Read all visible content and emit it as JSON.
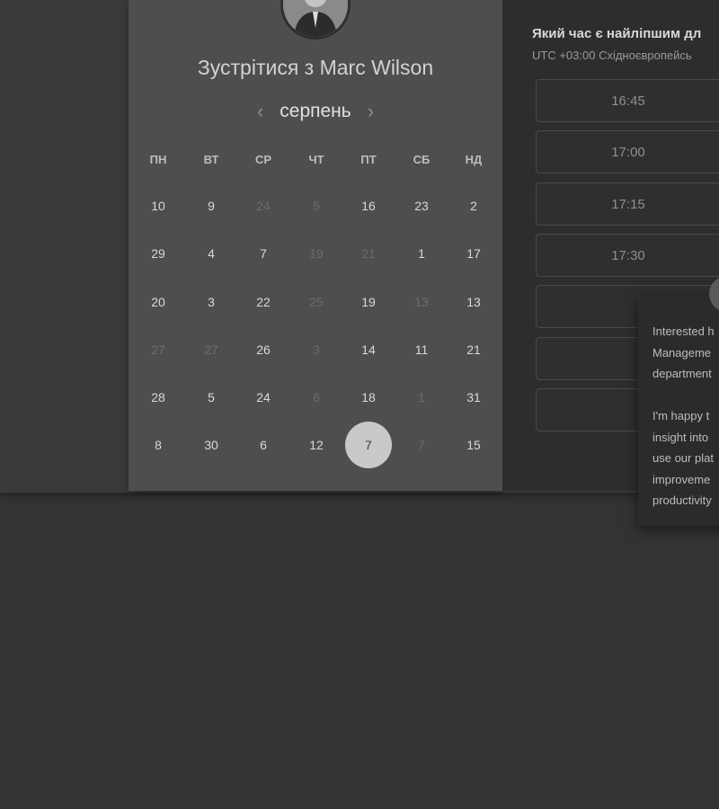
{
  "header": {
    "title": "Зустрітися з Marc Wilson",
    "month": "серпень",
    "prev_icon": "chevron-left-icon",
    "next_icon": "chevron-right-icon"
  },
  "calendar": {
    "weekdays": [
      "ПН",
      "ВТ",
      "СР",
      "ЧТ",
      "ПТ",
      "СБ",
      "НД"
    ],
    "weeks": [
      [
        {
          "d": "10"
        },
        {
          "d": "9"
        },
        {
          "d": "24",
          "muted": true
        },
        {
          "d": "5",
          "muted": true
        },
        {
          "d": "16"
        },
        {
          "d": "23"
        },
        {
          "d": "2"
        }
      ],
      [
        {
          "d": "29"
        },
        {
          "d": "4"
        },
        {
          "d": "7"
        },
        {
          "d": "19",
          "muted": true
        },
        {
          "d": "21",
          "muted": true
        },
        {
          "d": "1"
        },
        {
          "d": "17"
        }
      ],
      [
        {
          "d": "20"
        },
        {
          "d": "3"
        },
        {
          "d": "22"
        },
        {
          "d": "25",
          "muted": true
        },
        {
          "d": "19"
        },
        {
          "d": "13",
          "muted": true
        },
        {
          "d": "13"
        }
      ],
      [
        {
          "d": "27",
          "muted": true
        },
        {
          "d": "27",
          "muted": true
        },
        {
          "d": "26"
        },
        {
          "d": "3",
          "muted": true
        },
        {
          "d": "14"
        },
        {
          "d": "11"
        },
        {
          "d": "21"
        }
      ],
      [
        {
          "d": "28"
        },
        {
          "d": "5"
        },
        {
          "d": "24"
        },
        {
          "d": "6",
          "muted": true
        },
        {
          "d": "18"
        },
        {
          "d": "1",
          "muted": true
        },
        {
          "d": "31"
        }
      ],
      [
        {
          "d": "8"
        },
        {
          "d": "30"
        },
        {
          "d": "6"
        },
        {
          "d": "12"
        },
        {
          "d": "7",
          "selected": true
        },
        {
          "d": "7",
          "muted": true
        },
        {
          "d": "15"
        }
      ]
    ]
  },
  "times": {
    "question": "Який час є найліпшим дл",
    "timezone": "UTC +03:00 Східноєвропейсь",
    "slots": [
      "16:45",
      "17:00",
      "17:15",
      "17:30",
      "",
      "",
      ""
    ]
  },
  "popup": {
    "lines": [
      "Interested h",
      "Manageme",
      "department",
      "",
      "I'm happy t",
      "insight into",
      "use our plat",
      "improveme",
      "productivity"
    ]
  },
  "colors": {
    "page_bg": "#333333",
    "calendar_card": "#4e4e4e",
    "right_panel": "#2d2d2d",
    "selected_day": "#c9c9c9"
  }
}
